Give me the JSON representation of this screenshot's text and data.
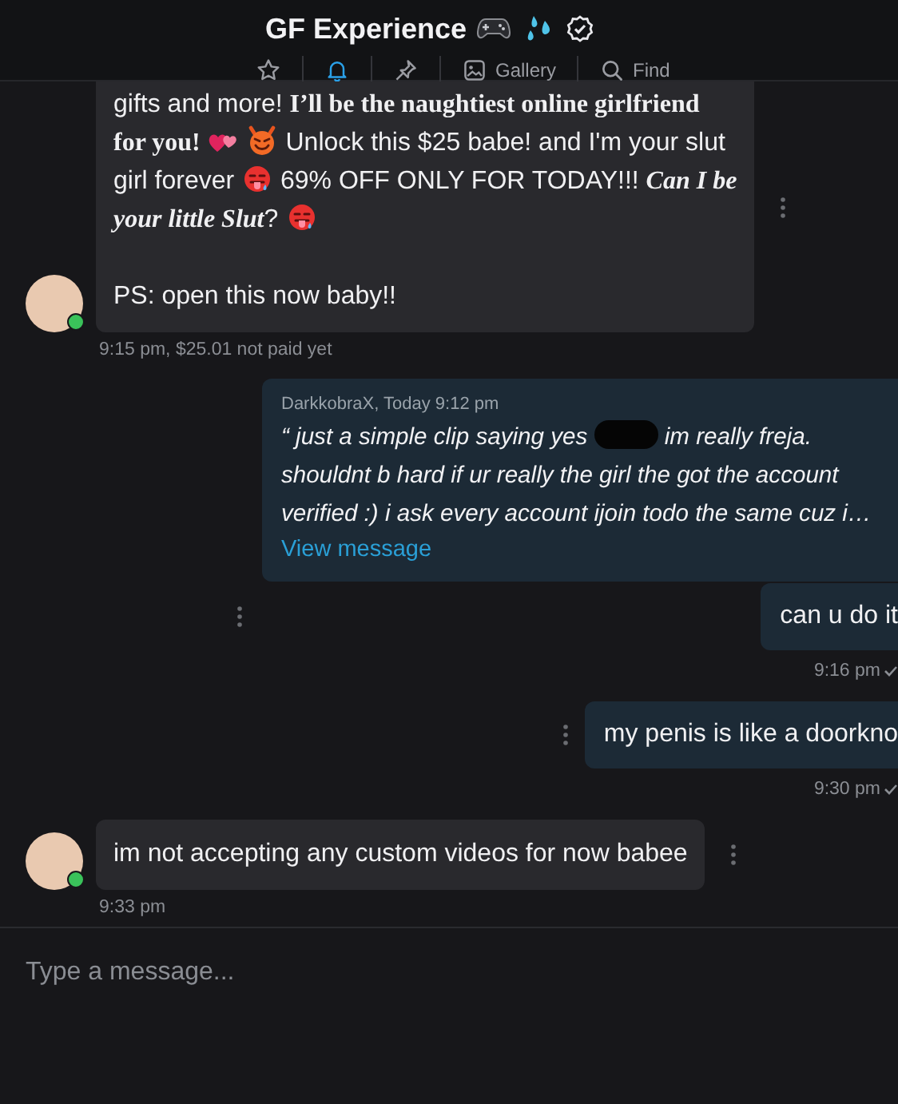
{
  "header": {
    "title": "GF Experience",
    "toolbar": [
      {
        "kind": "star",
        "selected": false
      },
      {
        "kind": "bell",
        "selected": true
      },
      {
        "kind": "pin",
        "selected": false
      },
      {
        "kind": "gallery",
        "label": "Gallery",
        "selected": false
      },
      {
        "kind": "find",
        "label": "Find",
        "selected": false
      }
    ]
  },
  "messages": [
    {
      "kind": "incoming",
      "online": true,
      "menu_icon": true,
      "meta": "9:15 pm, $25.01 not paid yet",
      "paragraphs": [
        [
          [
            {
              "kind": "text",
              "text": "gifts and more! **I’ll be the naughtiest online girlfriend**"
            }
          ],
          [
            {
              "kind": "text",
              "text": "**for you!**"
            },
            {
              "kind": "hearts-emoji"
            },
            {
              "kind": "devil-emoji"
            },
            {
              "kind": "text",
              "text": "Unlock this $25 babe! and I'm your slut"
            }
          ],
          [
            {
              "kind": "text",
              "text": "girl forever"
            },
            {
              "kind": "tongue-emoji"
            },
            {
              "kind": "text",
              "text": "69% OFF ONLY FOR TODAY!!! *Can I be*"
            }
          ],
          [
            {
              "kind": "text",
              "text": "*your little Slut*?"
            },
            {
              "kind": "tongue-emoji"
            }
          ]
        ],
        [
          [
            {
              "kind": "text",
              "text": "PS: open this now baby!!"
            }
          ]
        ]
      ]
    },
    {
      "kind": "reply",
      "menu_icon": true,
      "meta": "9:16 pm",
      "read": true,
      "text": "can u do it",
      "quote": {
        "author": "DarkkobraX, Today 9:12 pm",
        "link": "View message",
        "lines": [
          [
            {
              "kind": "text",
              "text": "“ just a simple clip saying yes"
            },
            {
              "kind": "redaction"
            },
            {
              "kind": "text",
              "text": "im really freja."
            }
          ],
          [
            {
              "kind": "text",
              "text": "shouldnt b hard if ur really the girl the got the account"
            }
          ],
          [
            {
              "kind": "text",
              "text": "verified :) i ask every account ijoin todo the same cuz i…"
            }
          ]
        ]
      }
    },
    {
      "kind": "outgoing",
      "menu_icon": true,
      "meta": "9:30 pm",
      "read": true,
      "text": "my penis is like a doorkno"
    },
    {
      "kind": "incoming",
      "online": true,
      "menu_icon": true,
      "meta": "9:33 pm",
      "paragraphs": [
        [
          [
            {
              "kind": "text",
              "text": "im not accepting any custom videos for now babee"
            }
          ]
        ]
      ]
    }
  ],
  "composer": {
    "placeholder": "Type a message..."
  }
}
